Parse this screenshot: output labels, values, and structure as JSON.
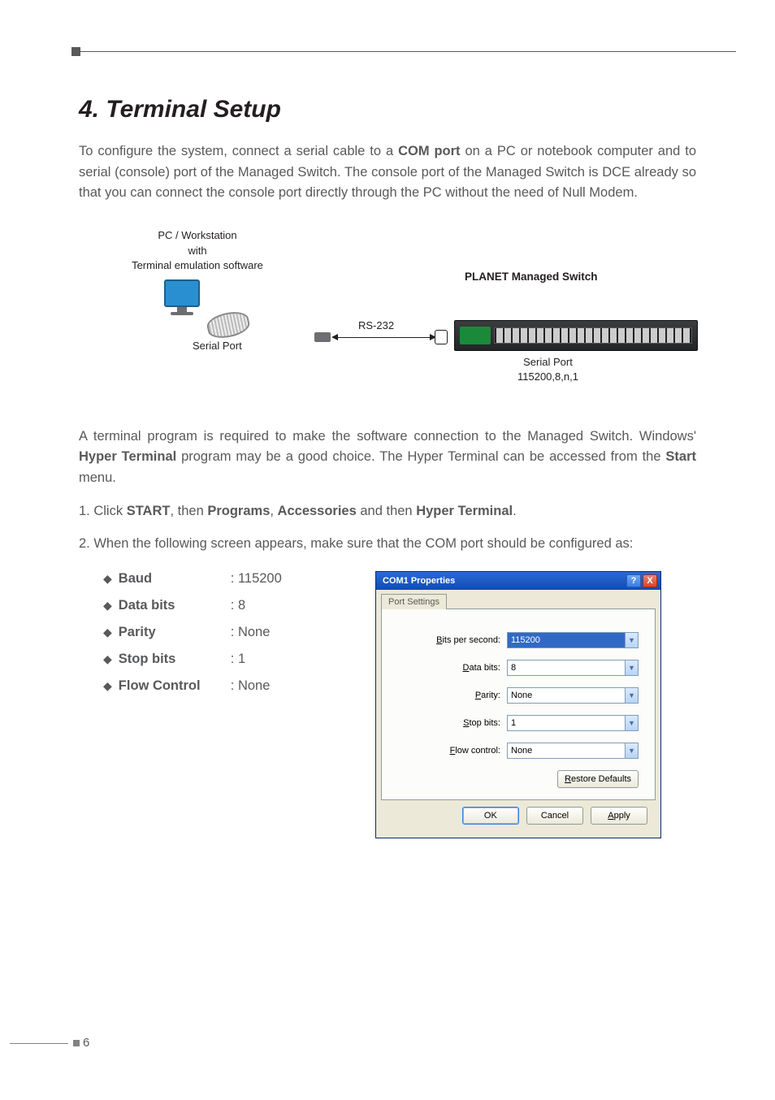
{
  "heading": "4. Terminal Setup",
  "intro": {
    "pre": "To configure the system, connect a serial cable to a ",
    "bold1": "COM port",
    "post": " on a PC or notebook computer and to serial (console) port of the Managed Switch. The console port of the Managed Switch is DCE already so that you can connect the console port directly through the PC without the need of Null Modem."
  },
  "diagram": {
    "pc_line1": "PC / Workstation",
    "pc_line2": "with",
    "pc_line3": "Terminal emulation software",
    "serial_port": "Serial Port",
    "rs232": "RS-232",
    "switch_title": "PLANET Managed Switch",
    "sp_bottom1": "Serial Port",
    "sp_bottom2": "115200,8,n,1"
  },
  "para2": {
    "pre": "A terminal program is required to make the software connection to the Managed Switch. Windows' ",
    "b1": "Hyper Terminal",
    "mid": " program may be a good choice. The Hyper Terminal can be accessed from the ",
    "b2": "Start",
    "post": " menu."
  },
  "step1": {
    "pre": "1. Click ",
    "b1": "START",
    "m1": ", then ",
    "b2": "Programs",
    "m2": ", ",
    "b3": "Accessories",
    "m3": " and then ",
    "b4": "Hyper Terminal",
    "post": "."
  },
  "step2": "2. When the following screen appears, make sure that the COM port should be configured as:",
  "config": [
    {
      "label": "Baud",
      "value": ": 115200"
    },
    {
      "label": "Data bits",
      "value": ": 8"
    },
    {
      "label": "Parity",
      "value": ": None"
    },
    {
      "label": "Stop bits",
      "value": ": 1"
    },
    {
      "label": "Flow Control",
      "value": ": None"
    }
  ],
  "dialog": {
    "title": "COM1 Properties",
    "tab": "Port Settings",
    "rows": [
      {
        "label_pre": "",
        "u": "B",
        "label_post": "its per second:",
        "value": "115200",
        "selected": true
      },
      {
        "label_pre": "",
        "u": "D",
        "label_post": "ata bits:",
        "value": "8",
        "selected": false
      },
      {
        "label_pre": "",
        "u": "P",
        "label_post": "arity:",
        "value": "None",
        "selected": false
      },
      {
        "label_pre": "",
        "u": "S",
        "label_post": "top bits:",
        "value": "1",
        "selected": false
      },
      {
        "label_pre": "",
        "u": "F",
        "label_post": "low control:",
        "value": "None",
        "selected": false
      }
    ],
    "restore_u": "R",
    "restore_post": "estore Defaults",
    "ok": "OK",
    "cancel": "Cancel",
    "apply_u": "A",
    "apply_post": "pply",
    "help": "?",
    "close": "X"
  },
  "page_number": "6"
}
